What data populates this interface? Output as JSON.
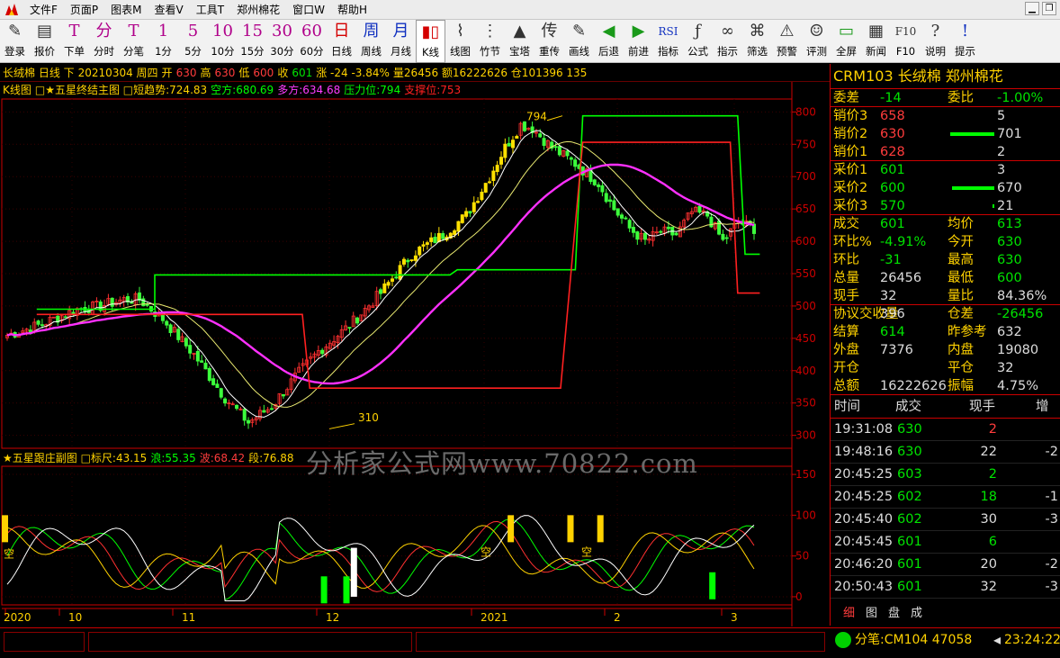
{
  "menus": [
    "文件F",
    "页面P",
    "图表M",
    "查看V",
    "工具T",
    "郑州棉花",
    "窗口W",
    "帮助H"
  ],
  "toolbar": [
    {
      "icon": "✎",
      "label": "登录",
      "cls": "dark"
    },
    {
      "icon": "▤",
      "label": "报价",
      "cls": "dark"
    },
    {
      "icon": "T",
      "label": "下单",
      "cls": ""
    },
    {
      "icon": "分",
      "label": "分时",
      "cls": ""
    },
    {
      "icon": "T",
      "label": "分笔",
      "cls": ""
    },
    {
      "icon": "1",
      "label": "1分",
      "cls": ""
    },
    {
      "icon": "5",
      "label": "5分",
      "cls": ""
    },
    {
      "icon": "10",
      "label": "10分",
      "cls": ""
    },
    {
      "icon": "15",
      "label": "15分",
      "cls": ""
    },
    {
      "icon": "30",
      "label": "30分",
      "cls": ""
    },
    {
      "icon": "60",
      "label": "60分",
      "cls": ""
    },
    {
      "icon": "日",
      "label": "日线",
      "cls": "red"
    },
    {
      "icon": "周",
      "label": "周线",
      "cls": "blue"
    },
    {
      "icon": "月",
      "label": "月线",
      "cls": "blue"
    },
    {
      "icon": "▮▯",
      "label": "K线",
      "cls": "red",
      "sel": true
    },
    {
      "icon": "⌇",
      "label": "线图",
      "cls": "dark"
    },
    {
      "icon": "⋮",
      "label": "竹节",
      "cls": "dark"
    },
    {
      "icon": "▲",
      "label": "宝塔",
      "cls": "dark"
    },
    {
      "icon": "传",
      "label": "重传",
      "cls": "dark"
    },
    {
      "icon": "✎",
      "label": "画线",
      "cls": "dark"
    },
    {
      "icon": "◀",
      "label": "后退",
      "cls": "green"
    },
    {
      "icon": "▶",
      "label": "前进",
      "cls": "green"
    },
    {
      "icon": "RSI",
      "label": "指标",
      "cls": "blue"
    },
    {
      "icon": "ƒ",
      "label": "公式",
      "cls": "dark"
    },
    {
      "icon": "∞",
      "label": "指示",
      "cls": "dark"
    },
    {
      "icon": "⌘",
      "label": "筛选",
      "cls": "dark"
    },
    {
      "icon": "⚠",
      "label": "预警",
      "cls": "dark"
    },
    {
      "icon": "☺",
      "label": "评测",
      "cls": "dark"
    },
    {
      "icon": "▭",
      "label": "全屏",
      "cls": "green"
    },
    {
      "icon": "▦",
      "label": "新闻",
      "cls": "dark"
    },
    {
      "icon": "F10",
      "label": "F10",
      "cls": "dark"
    },
    {
      "icon": "?",
      "label": "说明",
      "cls": "dark"
    },
    {
      "icon": "!",
      "label": "提示",
      "cls": "blue"
    }
  ],
  "quote_line": [
    {
      "t": "长绒棉 日线 下",
      "c": "#ffd200"
    },
    {
      "t": "20210304 周四",
      "c": "#ffd200"
    },
    {
      "t": "开",
      "c": "#ffd200"
    },
    {
      "t": "630",
      "c": "#ff3c3c"
    },
    {
      "t": "高",
      "c": "#ffd200"
    },
    {
      "t": "630",
      "c": "#ff3c3c"
    },
    {
      "t": "低",
      "c": "#ffd200"
    },
    {
      "t": "600",
      "c": "#ff3c3c"
    },
    {
      "t": "收",
      "c": "#ffd200"
    },
    {
      "t": "601",
      "c": "#00e400"
    },
    {
      "t": "涨 -24 -3.84%",
      "c": "#ffd200"
    },
    {
      "t": "量26456 额16222626 仓101396 135",
      "c": "#ffd200"
    }
  ],
  "indicator_line": [
    {
      "t": "K线图",
      "c": "#ffd200"
    },
    {
      "t": "□★五星终结主图 □短趋势:724.83",
      "c": "#ffd200"
    },
    {
      "t": "空方:680.69",
      "c": "#00ff00"
    },
    {
      "t": "多方:634.68",
      "c": "#ff3cff"
    },
    {
      "t": "压力位:794",
      "c": "#00ff00"
    },
    {
      "t": "支撑位:753",
      "c": "#ff2020"
    }
  ],
  "sub_line": [
    {
      "t": "★五星跟庄副图 □标尺:43.15",
      "c": "#ffd200"
    },
    {
      "t": "浪:55.35",
      "c": "#00ff00"
    },
    {
      "t": "波:68.42",
      "c": "#ff3c3c"
    },
    {
      "t": "段:76.88",
      "c": "#ffd200"
    }
  ],
  "watermark": "分析家公式网www.70822.com",
  "y_axis_main": [
    "800",
    "750",
    "700",
    "650",
    "600",
    "550",
    "500",
    "450",
    "400",
    "350",
    "300"
  ],
  "y_axis_sub": [
    "150",
    "100",
    "50",
    "0"
  ],
  "x_axis": [
    "2020",
    "10",
    "11",
    "12",
    "2021",
    "2",
    "3"
  ],
  "chart_annotations": {
    "high": "794",
    "low": "310",
    "short_label": "空"
  },
  "chart_data": {
    "type": "candlestick",
    "ylim": [
      280,
      820
    ],
    "sub_ylim": [
      -10,
      160
    ],
    "resistance": 794,
    "support": 753,
    "high_label": 794,
    "low_label": 310
  },
  "right_panel": {
    "title": "CRM103 长绒棉  郑州棉花",
    "rows": [
      {
        "a": "委差",
        "b": "-14",
        "bc": "#00e400",
        "c": "委比",
        "d": "-1.00%",
        "dc": "#00e400"
      },
      {
        "a": "销价3",
        "b": "658",
        "bc": "#ff3c3c",
        "d": "5",
        "dc": "#ddd"
      },
      {
        "a": "销价2",
        "b": "630",
        "bc": "#ff3c3c",
        "d": "701",
        "dc": "#ddd",
        "bar": 70
      },
      {
        "a": "销价1",
        "b": "628",
        "bc": "#ff3c3c",
        "d": "2",
        "dc": "#ddd"
      },
      {
        "a": "采价1",
        "b": "601",
        "bc": "#00e400",
        "d": "3",
        "dc": "#ddd"
      },
      {
        "a": "采价2",
        "b": "600",
        "bc": "#00e400",
        "d": "670",
        "dc": "#ddd",
        "bar": 67
      },
      {
        "a": "采价3",
        "b": "570",
        "bc": "#00e400",
        "d": "21",
        "dc": "#ddd",
        "bar": 3
      },
      {
        "a": "成交",
        "b": "601",
        "bc": "#00e400",
        "c": "均价",
        "d": "613",
        "dc": "#00e400"
      },
      {
        "a": "环比%",
        "b": "-4.91%",
        "bc": "#00e400",
        "c": "今开",
        "d": "630",
        "dc": "#00e400"
      },
      {
        "a": "环比",
        "b": "-31",
        "bc": "#00e400",
        "c": "最高",
        "d": "630",
        "dc": "#00e400"
      },
      {
        "a": "总量",
        "b": "26456",
        "bc": "#ddd",
        "c": "最低",
        "d": "600",
        "dc": "#00e400"
      },
      {
        "a": "现手",
        "b": "32",
        "bc": "#ddd",
        "c": "量比",
        "d": "84.36%",
        "dc": "#ddd"
      },
      {
        "a": "协议交收量",
        "b": "396",
        "bc": "#ddd",
        "c": "仓差",
        "d": "-26456",
        "dc": "#00e400"
      },
      {
        "a": "结算",
        "b": "614",
        "bc": "#00e400",
        "c": "昨参考",
        "d": "632",
        "dc": "#ddd"
      },
      {
        "a": "外盘",
        "b": "7376",
        "bc": "#ddd",
        "c": "内盘",
        "d": "19080",
        "dc": "#ddd"
      },
      {
        "a": "开仓",
        "b": "",
        "bc": "#ddd",
        "c": "平仓",
        "d": "32",
        "dc": "#ddd"
      },
      {
        "a": "总额",
        "b": "16222626",
        "bc": "#ddd",
        "c": "振幅",
        "d": "4.75%",
        "dc": "#ddd"
      }
    ],
    "tick_headers": [
      "时间",
      "成交",
      "现手",
      "增"
    ],
    "ticks": [
      {
        "time": "19:31:08",
        "price": "630",
        "vol": "2",
        "volc": "#ff3c3c",
        "inc": ""
      },
      {
        "time": "19:48:16",
        "price": "630",
        "vol": "22",
        "volc": "#ddd",
        "inc": "-2"
      },
      {
        "time": "20:45:25",
        "price": "603",
        "vol": "2",
        "volc": "#00e400",
        "inc": ""
      },
      {
        "time": "20:45:25",
        "price": "602",
        "vol": "18",
        "volc": "#00e400",
        "inc": "-1"
      },
      {
        "time": "20:45:40",
        "price": "602",
        "vol": "30",
        "volc": "#ddd",
        "inc": "-3"
      },
      {
        "time": "20:45:45",
        "price": "601",
        "vol": "6",
        "volc": "#00e400",
        "inc": ""
      },
      {
        "time": "20:46:20",
        "price": "601",
        "vol": "20",
        "volc": "#ddd",
        "inc": "-2"
      },
      {
        "time": "20:50:43",
        "price": "601",
        "vol": "32",
        "volc": "#ddd",
        "inc": "-3"
      }
    ],
    "tabs": [
      "细",
      "图",
      "盘",
      "成"
    ]
  },
  "status": {
    "quote": "分笔:CM104 47058",
    "clock": "23:24:22"
  }
}
